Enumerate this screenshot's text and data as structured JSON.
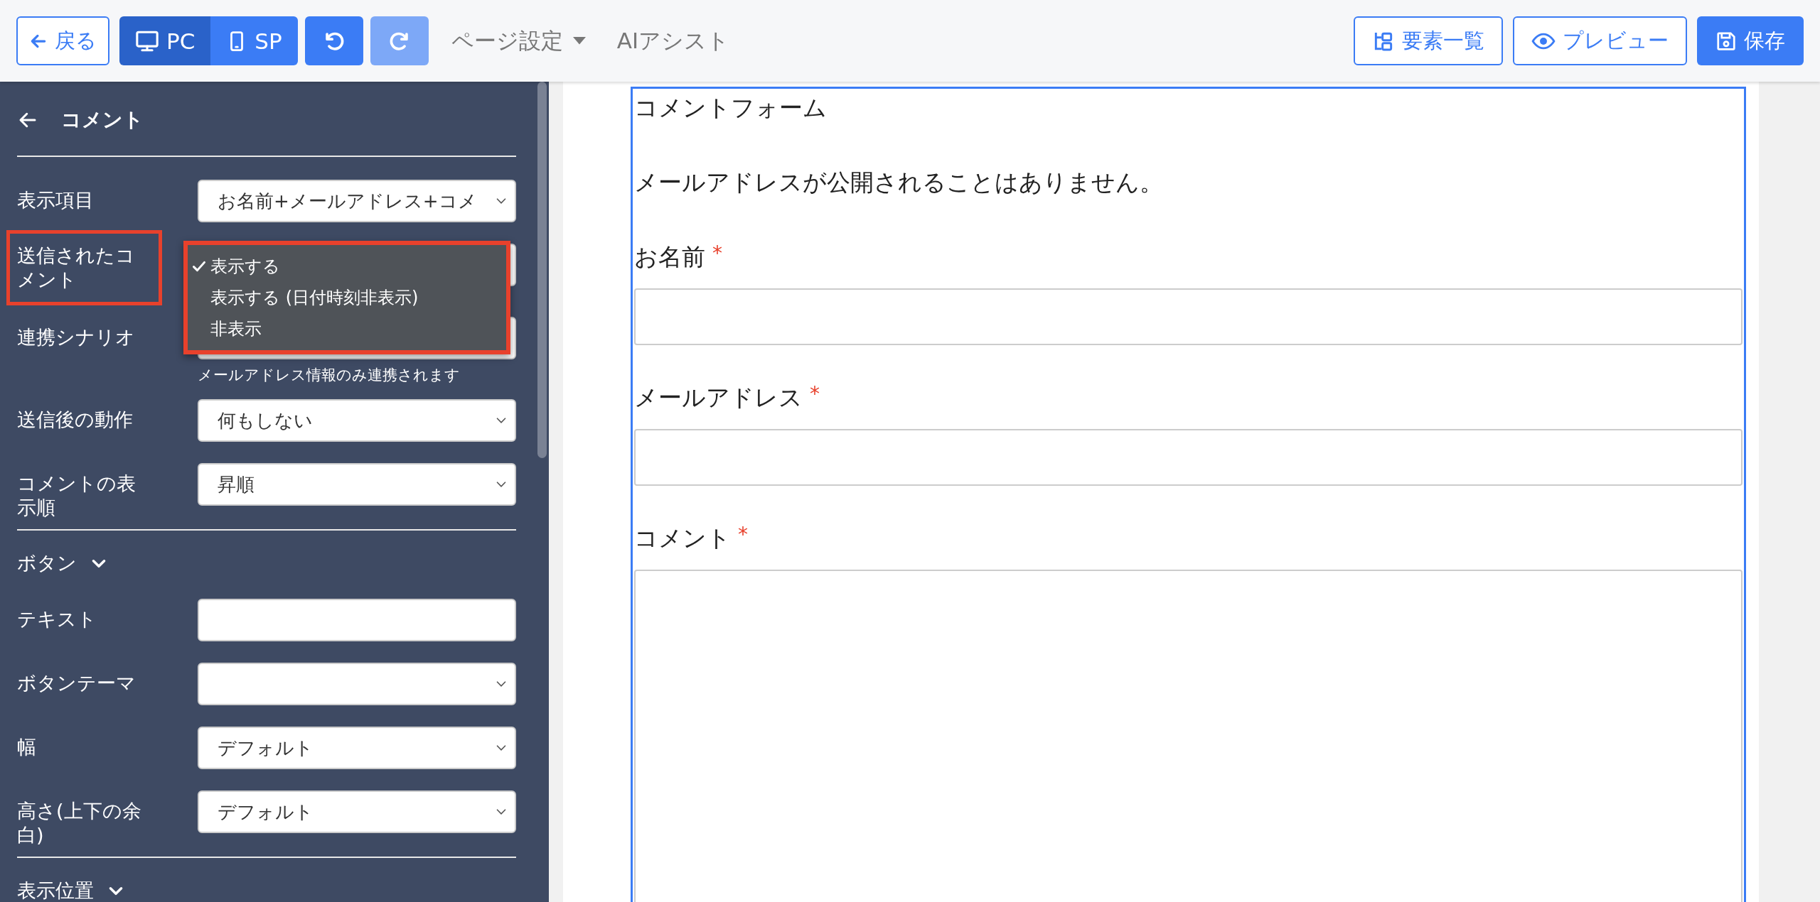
{
  "toolbar": {
    "back": "戻る",
    "device_tabs": [
      {
        "label": "PC",
        "kind": "desktop",
        "selected": true
      },
      {
        "label": "SP",
        "kind": "phone",
        "selected": false
      }
    ],
    "undo": {
      "disabled": false
    },
    "redo": {
      "disabled": true
    },
    "menus": [
      {
        "label": "ページ設定",
        "dropdown": true
      },
      {
        "label": "AIアシスト",
        "dropdown": false
      }
    ],
    "actions": [
      {
        "label": "要素一覧",
        "kind": "tree"
      },
      {
        "label": "プレビュー",
        "kind": "eye"
      },
      {
        "label": "保存",
        "kind": "save"
      }
    ]
  },
  "sidebar": {
    "title": "コメント",
    "sections": [
      {
        "rows": [
          {
            "label": "表示項目",
            "kind": "select",
            "value": "お名前+メールアドレス+コメ",
            "highlighted": false
          },
          {
            "label": "送信されたコメント",
            "kind": "select",
            "highlighted": true,
            "menu": [
              {
                "label": "表示する",
                "selected": true
              },
              {
                "label": "表示する (日付時刻非表示)",
                "selected": false
              },
              {
                "label": "非表示",
                "selected": false
              }
            ]
          },
          {
            "label": "連携シナリオ",
            "kind": "select",
            "highlighted": false,
            "hint": "メールアドレス情報のみ連携されます"
          },
          {
            "label": "送信後の動作",
            "kind": "select",
            "value": "何もしない",
            "highlighted": false
          },
          {
            "label": "コメントの表示順",
            "kind": "select",
            "value": "昇順",
            "highlighted": false
          }
        ]
      },
      {
        "heading": "ボタン",
        "rows": [
          {
            "label": "テキスト",
            "kind": "input",
            "highlighted": false
          },
          {
            "label": "ボタンテーマ",
            "kind": "select",
            "highlighted": false
          },
          {
            "label": "幅",
            "kind": "select",
            "value": "デフォルト",
            "highlighted": false
          },
          {
            "label": "高さ(上下の余白)",
            "kind": "select",
            "value": "デフォルト",
            "highlighted": false
          }
        ]
      },
      {
        "heading": "表示位置"
      }
    ]
  },
  "form": {
    "title": "コメントフォーム",
    "note": "メールアドレスが公開されることはありません。",
    "fields": [
      {
        "label": "お名前",
        "required_mark": "*",
        "kind": "input"
      },
      {
        "label": "メールアドレス",
        "required_mark": "*",
        "kind": "input"
      },
      {
        "label": "コメント",
        "required_mark": "*",
        "kind": "textarea"
      }
    ]
  }
}
